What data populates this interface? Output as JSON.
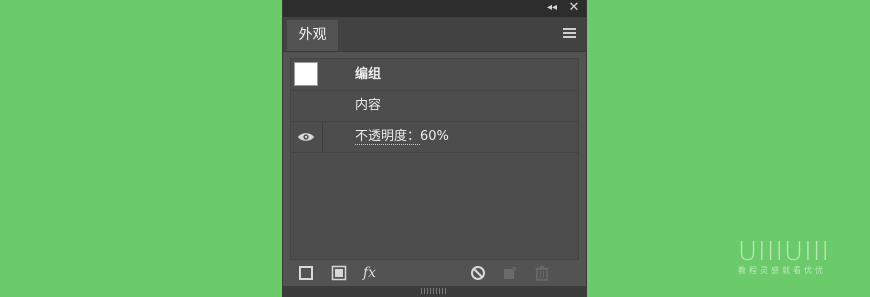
{
  "panel": {
    "tab_label": "外观",
    "collapse_glyph": "◂◂",
    "close_glyph": "✕"
  },
  "rows": {
    "group_label": "编组",
    "content_label": "内容",
    "opacity_label": "不透明度：",
    "opacity_value": "60%"
  },
  "bottom_icons": [
    "add-new-stroke-icon",
    "add-new-fill-icon",
    "add-effect-icon",
    "clear-appearance-icon",
    "duplicate-item-icon",
    "delete-item-icon"
  ],
  "fx_label": "fx",
  "colors": {
    "background": "#6bcb6b",
    "panel": "#535353",
    "panel_dark": "#2d2d2d"
  },
  "watermark": {
    "big": "UIIIUIII",
    "small": "教程灵感就看优优"
  }
}
